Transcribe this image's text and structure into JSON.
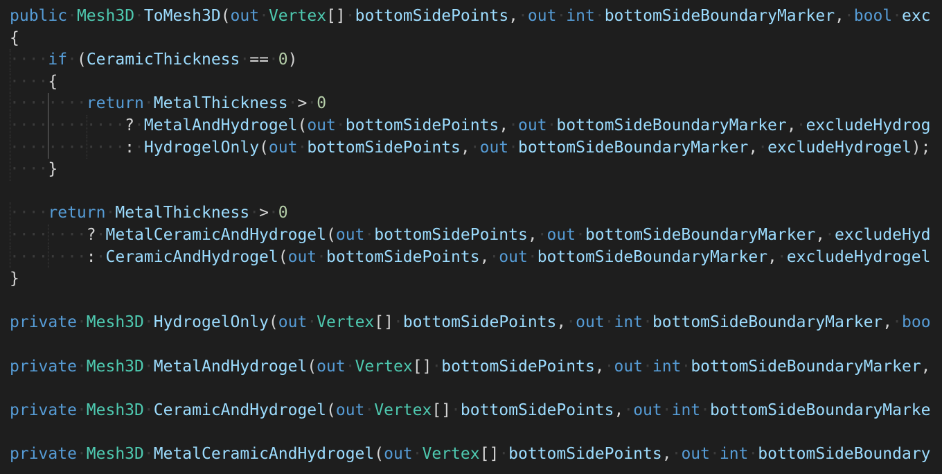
{
  "editor": {
    "colors": {
      "background": "#1e1e1e",
      "keyword": "#569cd6",
      "type": "#4ec9b0",
      "number": "#b5cea8",
      "function": "#dcdcaa",
      "identifier": "#9cdcfe",
      "plain": "#d4d4d4",
      "whitespace_dot": "#3b3b3b"
    },
    "lines": [
      {
        "indent": 0,
        "tokens": [
          [
            "kw",
            "public"
          ],
          [
            "sp"
          ],
          [
            "ty",
            "Mesh3D"
          ],
          [
            "sp"
          ],
          [
            "id",
            "ToMesh3D"
          ],
          [
            "pl",
            "("
          ],
          [
            "kw",
            "out"
          ],
          [
            "sp"
          ],
          [
            "ty",
            "Vertex"
          ],
          [
            "pl",
            "[]"
          ],
          [
            "sp"
          ],
          [
            "id",
            "bottomSidePoints"
          ],
          [
            "pl",
            ","
          ],
          [
            "sp"
          ],
          [
            "kw",
            "out"
          ],
          [
            "sp"
          ],
          [
            "kw",
            "int"
          ],
          [
            "sp"
          ],
          [
            "id",
            "bottomSideBoundaryMarker"
          ],
          [
            "pl",
            ","
          ],
          [
            "sp"
          ],
          [
            "kw",
            "bool"
          ],
          [
            "sp"
          ],
          [
            "id",
            "exc"
          ]
        ]
      },
      {
        "indent": 0,
        "tokens": [
          [
            "pl",
            "{"
          ]
        ]
      },
      {
        "indent": 4,
        "tokens": [
          [
            "kw",
            "if"
          ],
          [
            "sp"
          ],
          [
            "pl",
            "("
          ],
          [
            "id",
            "CeramicThickness"
          ],
          [
            "sp"
          ],
          [
            "pl",
            "=="
          ],
          [
            "sp"
          ],
          [
            "num",
            "0"
          ],
          [
            "pl",
            ")"
          ]
        ]
      },
      {
        "indent": 4,
        "tokens": [
          [
            "pl",
            "{"
          ]
        ]
      },
      {
        "indent": 8,
        "tokens": [
          [
            "kw",
            "return"
          ],
          [
            "sp"
          ],
          [
            "id",
            "MetalThickness"
          ],
          [
            "sp"
          ],
          [
            "pl",
            ">"
          ],
          [
            "sp"
          ],
          [
            "num",
            "0"
          ]
        ]
      },
      {
        "indent": 12,
        "tokens": [
          [
            "pl",
            "?"
          ],
          [
            "sp"
          ],
          [
            "id",
            "MetalAndHydrogel"
          ],
          [
            "pl",
            "("
          ],
          [
            "kw",
            "out"
          ],
          [
            "sp"
          ],
          [
            "id",
            "bottomSidePoints"
          ],
          [
            "pl",
            ","
          ],
          [
            "sp"
          ],
          [
            "kw",
            "out"
          ],
          [
            "sp"
          ],
          [
            "id",
            "bottomSideBoundaryMarker"
          ],
          [
            "pl",
            ","
          ],
          [
            "sp"
          ],
          [
            "id",
            "excludeHydrog"
          ]
        ]
      },
      {
        "indent": 12,
        "tokens": [
          [
            "pl",
            ":"
          ],
          [
            "sp"
          ],
          [
            "id",
            "HydrogelOnly"
          ],
          [
            "pl",
            "("
          ],
          [
            "kw",
            "out"
          ],
          [
            "sp"
          ],
          [
            "id",
            "bottomSidePoints"
          ],
          [
            "pl",
            ","
          ],
          [
            "sp"
          ],
          [
            "kw",
            "out"
          ],
          [
            "sp"
          ],
          [
            "id",
            "bottomSideBoundaryMarker"
          ],
          [
            "pl",
            ","
          ],
          [
            "sp"
          ],
          [
            "id",
            "excludeHydrogel"
          ],
          [
            "pl",
            ");"
          ]
        ]
      },
      {
        "indent": 4,
        "tokens": [
          [
            "pl",
            "}"
          ]
        ]
      },
      {
        "indent": 0,
        "tokens": []
      },
      {
        "indent": 4,
        "tokens": [
          [
            "kw",
            "return"
          ],
          [
            "sp"
          ],
          [
            "id",
            "MetalThickness"
          ],
          [
            "sp"
          ],
          [
            "pl",
            ">"
          ],
          [
            "sp"
          ],
          [
            "num",
            "0"
          ]
        ]
      },
      {
        "indent": 8,
        "tokens": [
          [
            "pl",
            "?"
          ],
          [
            "sp"
          ],
          [
            "id",
            "MetalCeramicAndHydrogel"
          ],
          [
            "pl",
            "("
          ],
          [
            "kw",
            "out"
          ],
          [
            "sp"
          ],
          [
            "id",
            "bottomSidePoints"
          ],
          [
            "pl",
            ","
          ],
          [
            "sp"
          ],
          [
            "kw",
            "out"
          ],
          [
            "sp"
          ],
          [
            "id",
            "bottomSideBoundaryMarker"
          ],
          [
            "pl",
            ","
          ],
          [
            "sp"
          ],
          [
            "id",
            "excludeHyd"
          ]
        ]
      },
      {
        "indent": 8,
        "tokens": [
          [
            "pl",
            ":"
          ],
          [
            "sp"
          ],
          [
            "id",
            "CeramicAndHydrogel"
          ],
          [
            "pl",
            "("
          ],
          [
            "kw",
            "out"
          ],
          [
            "sp"
          ],
          [
            "id",
            "bottomSidePoints"
          ],
          [
            "pl",
            ","
          ],
          [
            "sp"
          ],
          [
            "kw",
            "out"
          ],
          [
            "sp"
          ],
          [
            "id",
            "bottomSideBoundaryMarker"
          ],
          [
            "pl",
            ","
          ],
          [
            "sp"
          ],
          [
            "id",
            "excludeHydrogel"
          ]
        ]
      },
      {
        "indent": 0,
        "tokens": [
          [
            "pl",
            "}"
          ]
        ]
      },
      {
        "indent": 0,
        "tokens": []
      },
      {
        "indent": 0,
        "tokens": [
          [
            "kw",
            "private"
          ],
          [
            "sp"
          ],
          [
            "ty",
            "Mesh3D"
          ],
          [
            "sp"
          ],
          [
            "id",
            "HydrogelOnly"
          ],
          [
            "pl",
            "("
          ],
          [
            "kw",
            "out"
          ],
          [
            "sp"
          ],
          [
            "ty",
            "Vertex"
          ],
          [
            "pl",
            "[]"
          ],
          [
            "sp"
          ],
          [
            "id",
            "bottomSidePoints"
          ],
          [
            "pl",
            ","
          ],
          [
            "sp"
          ],
          [
            "kw",
            "out"
          ],
          [
            "sp"
          ],
          [
            "kw",
            "int"
          ],
          [
            "sp"
          ],
          [
            "id",
            "bottomSideBoundaryMarker"
          ],
          [
            "pl",
            ","
          ],
          [
            "sp"
          ],
          [
            "kw",
            "boo"
          ]
        ]
      },
      {
        "indent": 0,
        "tokens": []
      },
      {
        "indent": 0,
        "tokens": [
          [
            "kw",
            "private"
          ],
          [
            "sp"
          ],
          [
            "ty",
            "Mesh3D"
          ],
          [
            "sp"
          ],
          [
            "id",
            "MetalAndHydrogel"
          ],
          [
            "pl",
            "("
          ],
          [
            "kw",
            "out"
          ],
          [
            "sp"
          ],
          [
            "ty",
            "Vertex"
          ],
          [
            "pl",
            "[]"
          ],
          [
            "sp"
          ],
          [
            "id",
            "bottomSidePoints"
          ],
          [
            "pl",
            ","
          ],
          [
            "sp"
          ],
          [
            "kw",
            "out"
          ],
          [
            "sp"
          ],
          [
            "kw",
            "int"
          ],
          [
            "sp"
          ],
          [
            "id",
            "bottomSideBoundaryMarker"
          ],
          [
            "pl",
            ","
          ]
        ]
      },
      {
        "indent": 0,
        "tokens": []
      },
      {
        "indent": 0,
        "tokens": [
          [
            "kw",
            "private"
          ],
          [
            "sp"
          ],
          [
            "ty",
            "Mesh3D"
          ],
          [
            "sp"
          ],
          [
            "id",
            "CeramicAndHydrogel"
          ],
          [
            "pl",
            "("
          ],
          [
            "kw",
            "out"
          ],
          [
            "sp"
          ],
          [
            "ty",
            "Vertex"
          ],
          [
            "pl",
            "[]"
          ],
          [
            "sp"
          ],
          [
            "id",
            "bottomSidePoints"
          ],
          [
            "pl",
            ","
          ],
          [
            "sp"
          ],
          [
            "kw",
            "out"
          ],
          [
            "sp"
          ],
          [
            "kw",
            "int"
          ],
          [
            "sp"
          ],
          [
            "id",
            "bottomSideBoundaryMarke"
          ]
        ]
      },
      {
        "indent": 0,
        "tokens": []
      },
      {
        "indent": 0,
        "tokens": [
          [
            "kw",
            "private"
          ],
          [
            "sp"
          ],
          [
            "ty",
            "Mesh3D"
          ],
          [
            "sp"
          ],
          [
            "id",
            "MetalCeramicAndHydrogel"
          ],
          [
            "pl",
            "("
          ],
          [
            "kw",
            "out"
          ],
          [
            "sp"
          ],
          [
            "ty",
            "Vertex"
          ],
          [
            "pl",
            "[]"
          ],
          [
            "sp"
          ],
          [
            "id",
            "bottomSidePoints"
          ],
          [
            "pl",
            ","
          ],
          [
            "sp"
          ],
          [
            "kw",
            "out"
          ],
          [
            "sp"
          ],
          [
            "kw",
            "int"
          ],
          [
            "sp"
          ],
          [
            "id",
            "bottomSideBoundary"
          ]
        ]
      }
    ]
  }
}
